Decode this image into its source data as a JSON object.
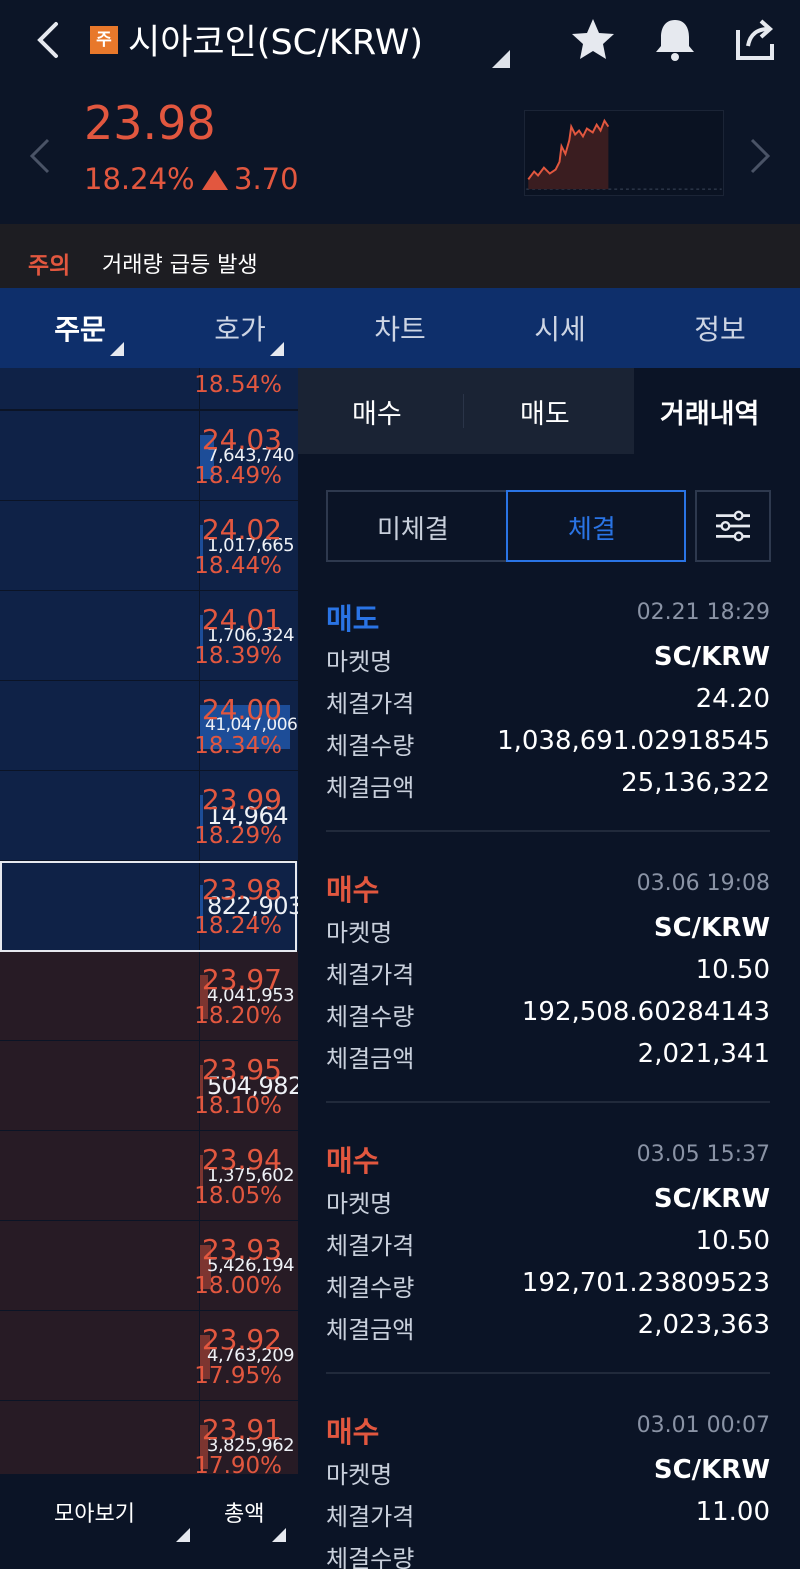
{
  "header": {
    "badge": "주",
    "title": "시아코인(SC/KRW)",
    "price": "23.98",
    "change_pct": "18.24%",
    "change_abs": "3.70",
    "icons": [
      "back-icon",
      "star-icon",
      "bell-icon",
      "share-icon"
    ]
  },
  "alert": {
    "tag": "주의",
    "text": "거래량 급등 발생"
  },
  "tabs": [
    {
      "label": "주문",
      "active": true
    },
    {
      "label": "호가",
      "active": false
    },
    {
      "label": "차트",
      "active": false
    },
    {
      "label": "시세",
      "active": false
    },
    {
      "label": "정보",
      "active": false
    }
  ],
  "orderbook": {
    "partial_top": {
      "pct": "18.54%"
    },
    "asks": [
      {
        "price": "24.03",
        "pct": "18.49%",
        "volume": "7,643,740",
        "fill": 0.14
      },
      {
        "price": "24.02",
        "pct": "18.44%",
        "volume": "1,017,665",
        "fill": 0.02
      },
      {
        "price": "24.01",
        "pct": "18.39%",
        "volume": "1,706,324",
        "fill": 0.03
      },
      {
        "price": "24.00",
        "pct": "18.34%",
        "volume": "41,047,006",
        "fill": 0.92
      },
      {
        "price": "23.99",
        "pct": "18.29%",
        "volume": "14,964",
        "fill": 0.0
      }
    ],
    "current": {
      "price": "23.98",
      "pct": "18.24%",
      "volume": "822,903",
      "fill": 0.02
    },
    "bids": [
      {
        "price": "23.97",
        "pct": "18.20%",
        "volume": "4,041,953",
        "fill": 0.08
      },
      {
        "price": "23.95",
        "pct": "18.10%",
        "volume": "504,982",
        "fill": 0.01
      },
      {
        "price": "23.94",
        "pct": "18.05%",
        "volume": "1,375,602",
        "fill": 0.03
      },
      {
        "price": "23.93",
        "pct": "18.00%",
        "volume": "5,426,194",
        "fill": 0.11
      },
      {
        "price": "23.92",
        "pct": "17.95%",
        "volume": "4,763,209",
        "fill": 0.1
      },
      {
        "price": "23.91",
        "pct": "17.90%",
        "volume": "3,825,962",
        "fill": 0.08
      }
    ]
  },
  "bottom": {
    "group_view": "모아보기",
    "total": "총액"
  },
  "panel": {
    "sub_tabs": [
      "매수",
      "매도",
      "거래내역"
    ],
    "segments": [
      "미체결",
      "체결"
    ],
    "labels": {
      "market": "마켓명",
      "price": "체결가격",
      "qty": "체결수량",
      "amount": "체결금액"
    },
    "trades": [
      {
        "side": "매도",
        "type": "sell",
        "date": "02.21 18:29",
        "market": "SC/KRW",
        "price": "24.20",
        "qty": "1,038,691.02918545",
        "amount": "25,136,322"
      },
      {
        "side": "매수",
        "type": "buy",
        "date": "03.06 19:08",
        "market": "SC/KRW",
        "price": "10.50",
        "qty": "192,508.60284143",
        "amount": "2,021,341"
      },
      {
        "side": "매수",
        "type": "buy",
        "date": "03.05 15:37",
        "market": "SC/KRW",
        "price": "10.50",
        "qty": "192,701.23809523",
        "amount": "2,023,363"
      },
      {
        "side": "매수",
        "type": "buy",
        "date": "03.01 00:07",
        "market": "SC/KRW",
        "price": "11.00",
        "qty": "",
        "amount": ""
      }
    ]
  },
  "colors": {
    "up": "#e2573f",
    "down": "#2a74e5",
    "nav": "#0e2f6b",
    "bg": "#0b1426"
  }
}
